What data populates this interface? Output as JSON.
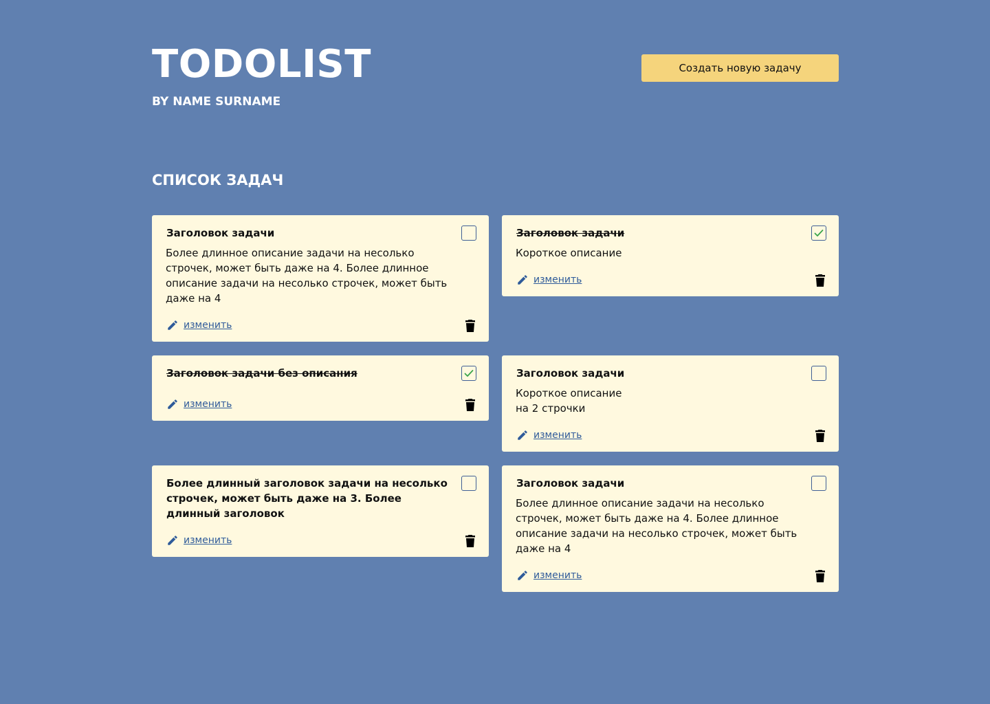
{
  "header": {
    "title": "TODOLIST",
    "author": "BY NAME SURNAME",
    "create_button_label": "Создать новую задачу"
  },
  "list": {
    "heading": "СПИСОК ЗАДАЧ"
  },
  "colors": {
    "background": "#6080b0",
    "card": "#fff9df",
    "button": "#f5d47c",
    "check": "#3aa54a",
    "link": "#2f5b9a"
  },
  "tasks": [
    {
      "title": "Заголовок задачи",
      "description": "Более длинное описание задачи на несолько строчек, может быть даже на 4. Более длинное описание задачи на несолько строчек, может быть даже на 4",
      "completed": false,
      "edit_label": "изменить",
      "edit_icon": "pencil-icon",
      "delete_icon": "trash-icon"
    },
    {
      "title": "Заголовок задачи",
      "description": "Короткое описание",
      "completed": true,
      "edit_label": "изменить",
      "edit_icon": "pencil-icon",
      "delete_icon": "trash-icon"
    },
    {
      "title": "Заголовок задачи без описания",
      "description": "",
      "completed": true,
      "edit_label": "изменить",
      "edit_icon": "pencil-icon",
      "delete_icon": "trash-icon"
    },
    {
      "title": "Заголовок задачи",
      "description": "Короткое описание\nна 2 строчки",
      "completed": false,
      "edit_label": "изменить",
      "edit_icon": "pencil-icon",
      "delete_icon": "trash-icon"
    },
    {
      "title": "Более длинный заголовок задачи на несолько строчек, может быть даже на 3. Более длинный заголовок",
      "description": "",
      "completed": false,
      "edit_label": "изменить",
      "edit_icon": "pencil-icon",
      "delete_icon": "trash-icon"
    },
    {
      "title": "Заголовок задачи",
      "description": "Более длинное описание задачи на несолько строчек, может быть даже на 4. Более длинное описание задачи на несолько строчек, может быть даже на 4",
      "completed": false,
      "edit_label": "изменить",
      "edit_icon": "pencil-icon",
      "delete_icon": "trash-icon"
    }
  ]
}
